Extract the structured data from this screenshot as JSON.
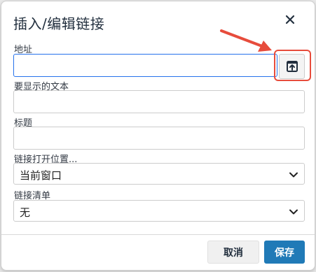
{
  "dialog": {
    "title": "插入/编辑链接",
    "close_icon": "close-icon"
  },
  "fields": {
    "url_label": "地址",
    "url_value": "",
    "browse_icon": "browse-upload-icon",
    "text_label": "要显示的文本",
    "text_value": "",
    "title_label": "标题",
    "title_value": "",
    "target_label": "链接打开位置...",
    "target_value": "当前窗口",
    "link_list_label": "链接清单",
    "link_list_value": "无"
  },
  "footer": {
    "cancel_label": "取消",
    "save_label": "保存"
  },
  "colors": {
    "accent": "#207ab7",
    "focus_border": "#2672ec",
    "annotation": "#e74c3c"
  }
}
